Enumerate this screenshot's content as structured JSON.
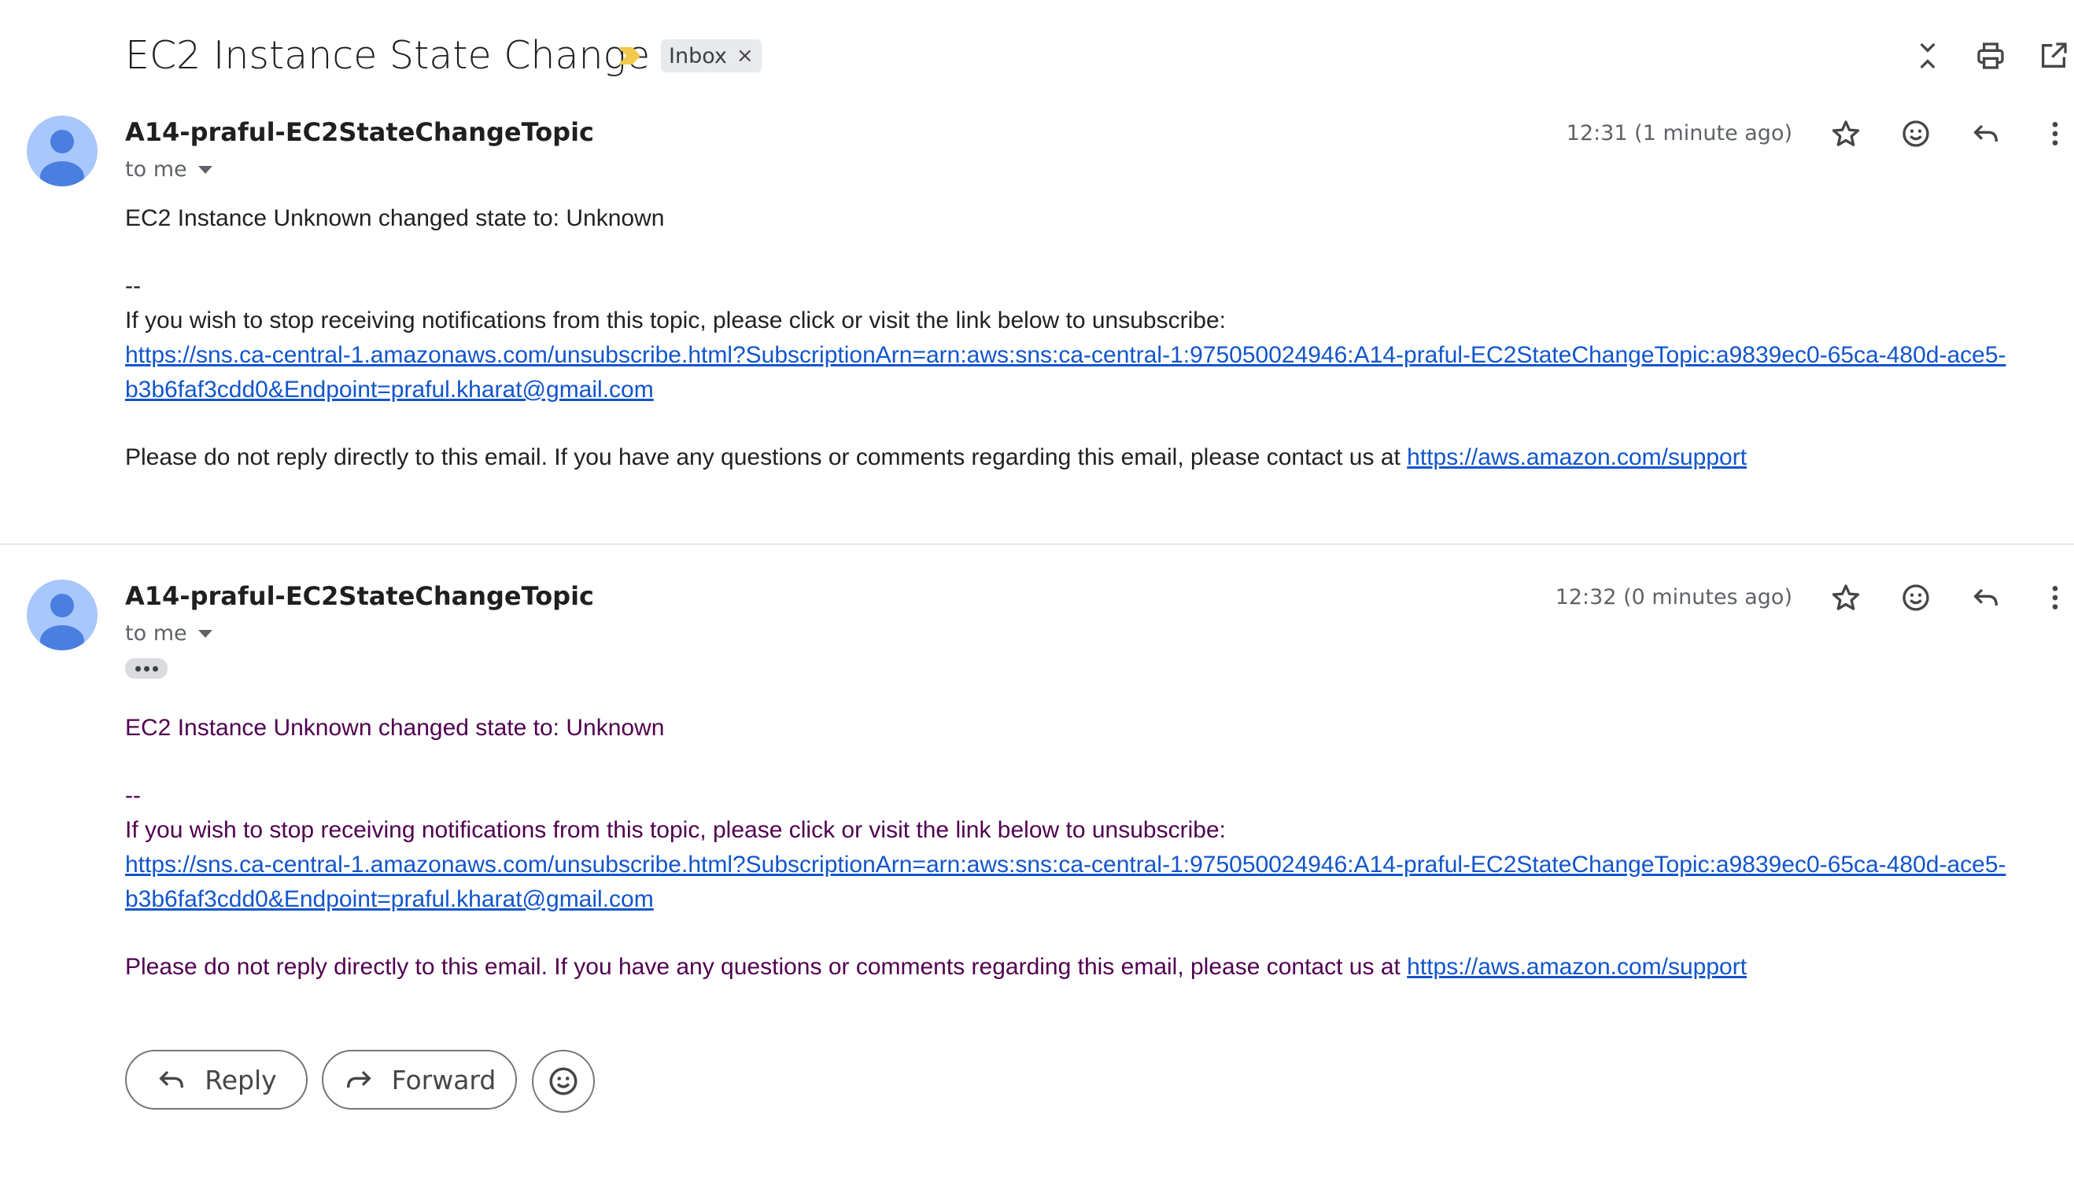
{
  "subject": "EC2 Instance State Change",
  "label": {
    "name": "Inbox",
    "remove_glyph": "×"
  },
  "top_actions": {
    "icons": [
      "collapse-all-icon",
      "print-icon",
      "open-in-new-window-icon"
    ]
  },
  "messages": [
    {
      "sender": "A14-praful-EC2StateChangeTopic",
      "recipient": "to me",
      "time": "12:31 (1 minute ago)",
      "line1": "EC2 Instance Unknown changed state to: Unknown",
      "separator": "--",
      "unsub_text": "If you wish to stop receiving notifications from this topic, please click or visit the link below to unsubscribe:",
      "unsub_link_line1": "https://sns.ca-central-1.amazonaws.com/unsubscribe.html?SubscriptionArn=arn:aws:sns:ca-central-1:975050024946:A14-praful-EC2StateChangeTopic:a9839ec0-65ca-480d-ace5-",
      "unsub_link_line2": "b3b6faf3cdd0&Endpoint=praful.kharat@gmail.com",
      "footer_text": "Please do not reply directly to this email. If you have any questions or comments regarding this email, please contact us at ",
      "footer_link": "https://aws.amazon.com/support"
    },
    {
      "sender": "A14-praful-EC2StateChangeTopic",
      "recipient": "to me",
      "time": "12:32 (0 minutes ago)",
      "line1": "EC2 Instance Unknown changed state to: Unknown",
      "separator": "--",
      "unsub_text": "If you wish to stop receiving notifications from this topic, please click or visit the link below to unsubscribe:",
      "unsub_link_line1": "https://sns.ca-central-1.amazonaws.com/unsubscribe.html?SubscriptionArn=arn:aws:sns:ca-central-1:975050024946:A14-praful-EC2StateChangeTopic:a9839ec0-65ca-480d-ace5-",
      "unsub_link_line2": "b3b6faf3cdd0&Endpoint=praful.kharat@gmail.com",
      "footer_text": "Please do not reply directly to this email. If you have any questions or comments regarding this email, please contact us at ",
      "footer_link": "https://aws.amazon.com/support"
    }
  ],
  "actions": {
    "reply": "Reply",
    "forward": "Forward"
  },
  "colors": {
    "link": "#1155cc",
    "quoted_text": "#500050",
    "importance_marker": "#f2c94c",
    "avatar_bg": "#a8c7fa",
    "avatar_fg": "#4a7fe0"
  }
}
